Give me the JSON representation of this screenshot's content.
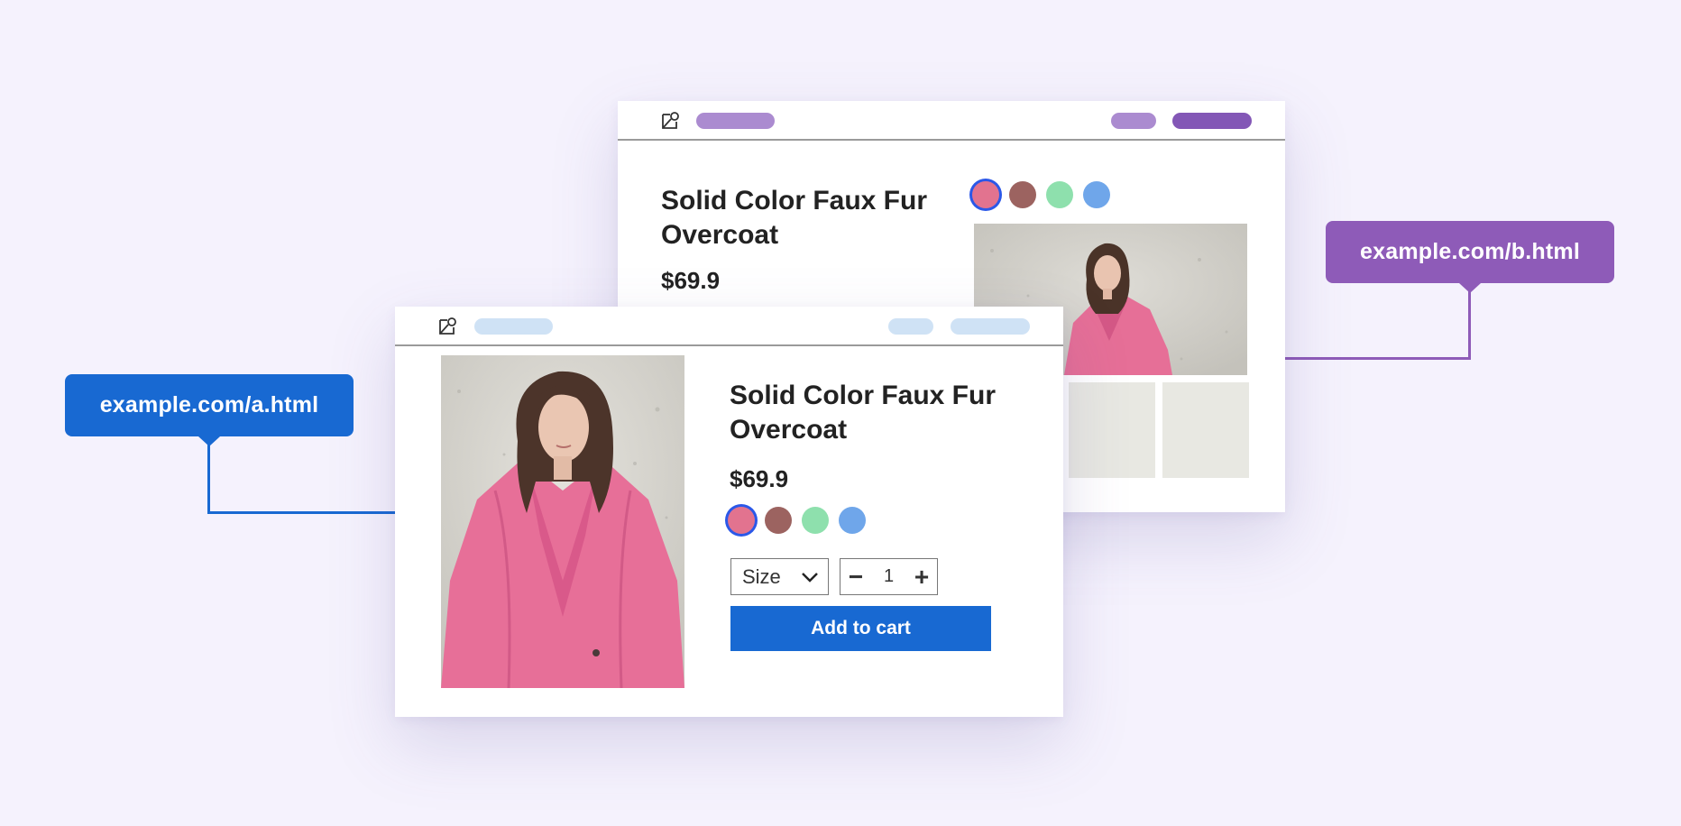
{
  "product": {
    "title": "Solid Color Faux Fur Overcoat",
    "price": "$69.9"
  },
  "swatches": [
    {
      "color": "#e2738f",
      "selected": true
    },
    {
      "color": "#9c6360",
      "selected": false
    },
    {
      "color": "#8ee0ad",
      "selected": false
    },
    {
      "color": "#6fa6ea",
      "selected": false
    }
  ],
  "controls": {
    "size_label": "Size",
    "quantity": "1",
    "minus_symbol": "−",
    "plus_symbol": "+"
  },
  "cta": {
    "add_to_cart_label": "Add to cart"
  },
  "tags": {
    "a_url": "example.com/a.html",
    "b_url": "example.com/b.html"
  },
  "colors": {
    "background": "#f5f2fd",
    "version_a_accent": "#1869d2",
    "version_b_accent": "#8e5bb8",
    "version_a_nav_pill": "#cfe2f5",
    "version_b_nav_pill_light": "#ab8bd0",
    "version_b_nav_pill_dark": "#8357b6",
    "thumbnail": "#e8e8e2"
  },
  "icons": {
    "logo": "shape-logo-icon",
    "dropdown": "chevron-down-icon"
  }
}
